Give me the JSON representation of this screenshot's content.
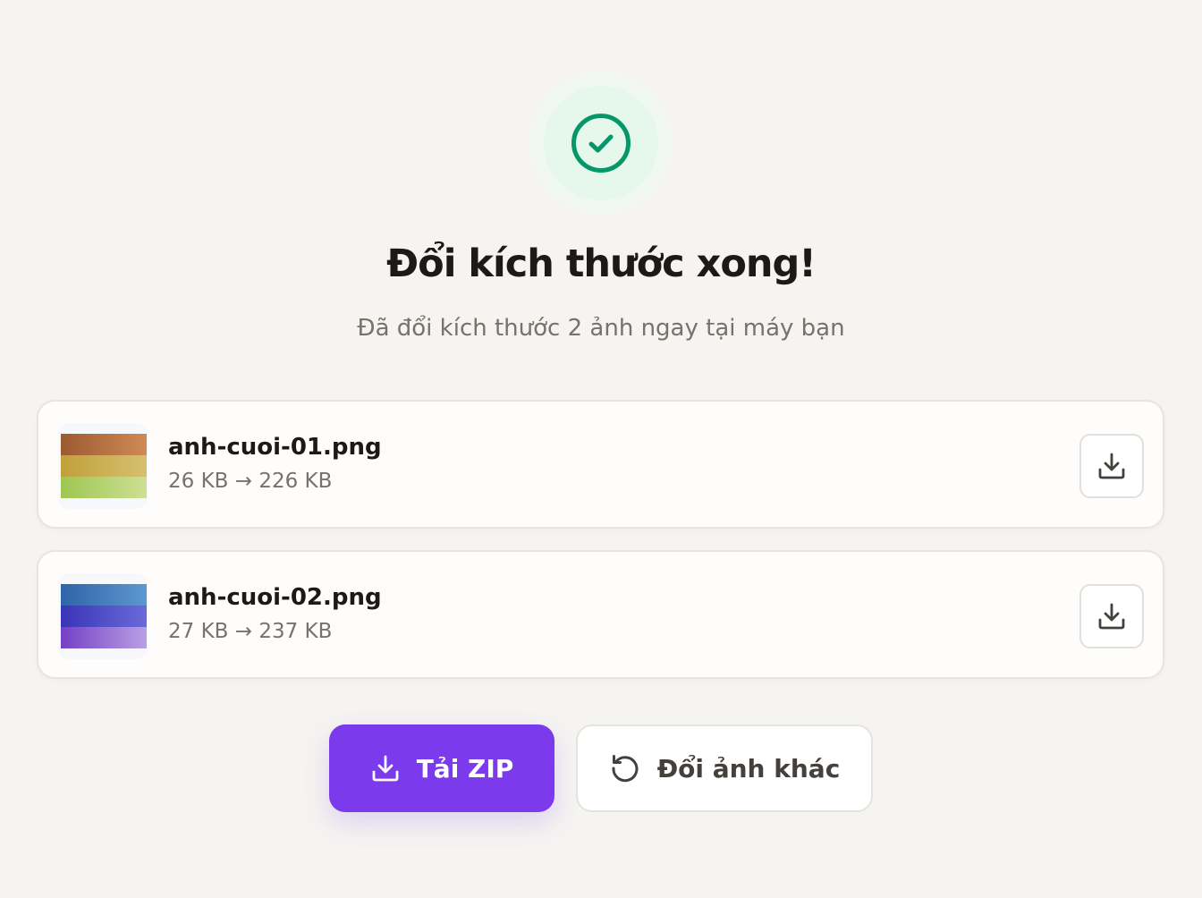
{
  "header": {
    "title": "Đổi kích thước xong!",
    "subtitle": "Đã đổi kích thước 2 ảnh ngay tại máy bạn"
  },
  "files": [
    {
      "name": "anh-cuoi-01.png",
      "size": "26 KB → 226 KB",
      "thumb_colors": [
        "#b8693a",
        "#c8b04a",
        "#a8cc5c"
      ]
    },
    {
      "name": "anh-cuoi-02.png",
      "size": "27 KB → 237 KB",
      "thumb_colors": [
        "#3f7cc0",
        "#4a42c8",
        "#8a5ad0"
      ]
    }
  ],
  "actions": {
    "zip_label": "Tải ZIP",
    "other_label": "Đổi ảnh khác"
  },
  "icons": {
    "success": "check-circle-icon",
    "download": "download-icon",
    "retry": "rotate-ccw-icon"
  },
  "colors": {
    "accent": "#7c3aed",
    "success": "#059669",
    "background": "#f5f4f1"
  }
}
